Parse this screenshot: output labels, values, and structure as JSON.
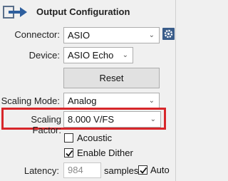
{
  "header": {
    "title": "Output Configuration",
    "icon": "output-arrow-icon"
  },
  "connector": {
    "label": "Connector:",
    "value": "ASIO",
    "settings_icon": "gear-icon"
  },
  "device": {
    "label": "Device:",
    "value": "ASIO Echo"
  },
  "reset": {
    "label": "Reset"
  },
  "scaling_mode": {
    "label": "Scaling Mode:",
    "value": "Analog"
  },
  "scaling_factor": {
    "label": "Scaling Factor:",
    "value": "8.000 V/FS",
    "highlight_color": "#d7262a"
  },
  "acoustic": {
    "label": "Acoustic",
    "checked": false
  },
  "enable_dither": {
    "label": "Enable Dither",
    "checked": true
  },
  "latency": {
    "label": "Latency:",
    "value": "984",
    "unit": "samples",
    "auto_label": "Auto",
    "auto_checked": true
  }
}
